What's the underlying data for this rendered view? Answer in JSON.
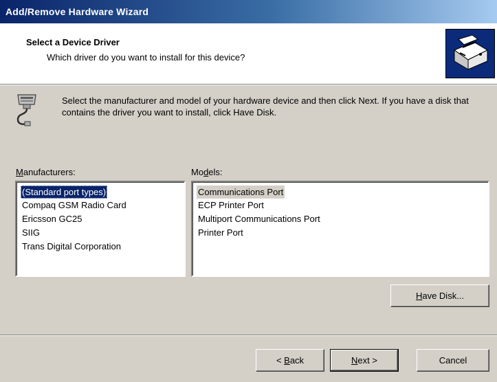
{
  "window": {
    "title": "Add/Remove Hardware Wizard"
  },
  "header": {
    "title": "Select a Device Driver",
    "subtitle": "Which driver do you want to install for this device?"
  },
  "info": {
    "text": "Select the manufacturer and model of your hardware device and then click Next. If you have a disk that contains the driver you want to install, click Have Disk."
  },
  "manufacturers": {
    "label_pre": "",
    "label_key": "M",
    "label_post": "anufacturers:",
    "items": [
      "(Standard port types)",
      "Compaq GSM Radio Card",
      "Ericsson GC25",
      "SIIG",
      "Trans Digital Corporation"
    ],
    "selected": "(Standard port types)"
  },
  "models": {
    "label_pre": "Mo",
    "label_key": "d",
    "label_post": "els:",
    "items": [
      "Communications Port",
      "ECP Printer Port",
      "Multiport Communications Port",
      "Printer Port"
    ],
    "selected": "Communications Port"
  },
  "buttons": {
    "have_disk": {
      "key": "H",
      "rest": "ave Disk..."
    },
    "back": {
      "pre": "< ",
      "key": "B",
      "rest": "ack"
    },
    "next": {
      "key": "N",
      "rest": "ext >"
    },
    "cancel": "Cancel"
  },
  "colors": {
    "selection": "#0a246a",
    "title_start": "#0a246a",
    "title_end": "#a6caf0",
    "face": "#d4d0c8"
  },
  "icons": {
    "header": "hardware-device-icon",
    "info": "port-connector-icon"
  }
}
